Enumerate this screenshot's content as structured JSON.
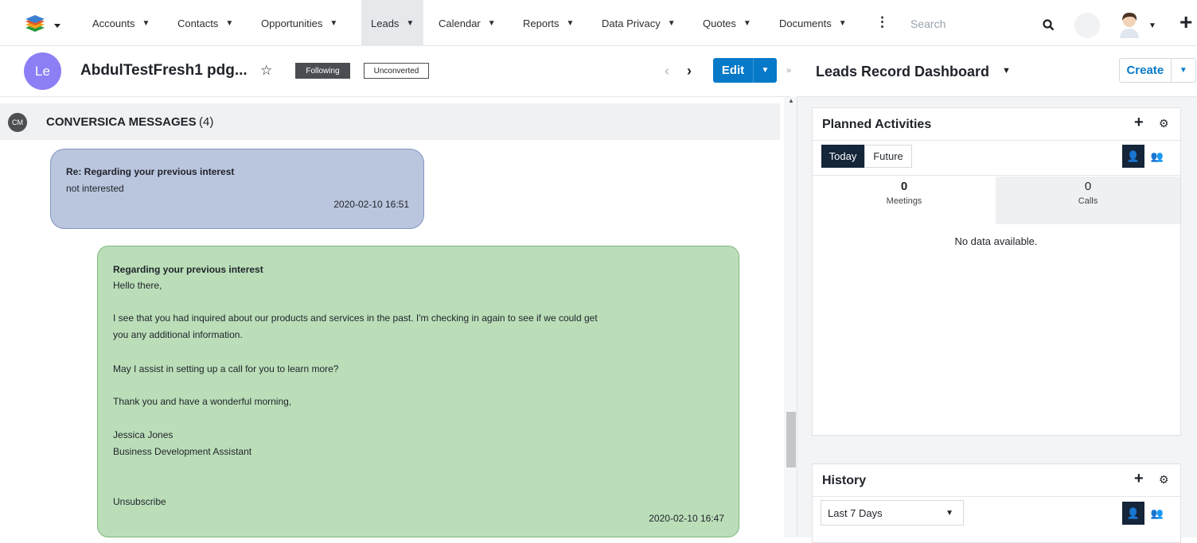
{
  "nav": {
    "items": [
      {
        "label": "Accounts"
      },
      {
        "label": "Contacts"
      },
      {
        "label": "Opportunities"
      },
      {
        "label": "Leads"
      },
      {
        "label": "Calendar"
      },
      {
        "label": "Reports"
      },
      {
        "label": "Data Privacy"
      },
      {
        "label": "Quotes"
      },
      {
        "label": "Documents"
      }
    ],
    "search_placeholder": "Search"
  },
  "record": {
    "avatar_initials": "Le",
    "title": "AbdulTestFresh1 pdg...",
    "following_badge": "Following",
    "status_badge": "Unconverted",
    "edit_label": "Edit"
  },
  "subpanel": {
    "icon_text": "CM",
    "title": "CONVERSICA MESSAGES",
    "count": "(4)"
  },
  "messages": [
    {
      "subject": "Re: Regarding your previous interest",
      "body": "not interested",
      "timestamp": "2020-02-10 16:51"
    },
    {
      "subject": "Regarding your previous interest",
      "lines": [
        "Hello there,",
        "I see that you had inquired about our products and services in the past. I'm checking in again to see if we could get",
        "you any additional information.",
        "May I assist in setting up a call for you to learn more?",
        "Thank you and have a wonderful morning,",
        "Jessica Jones",
        "Business Development Assistant",
        "Unsubscribe"
      ],
      "timestamp": "2020-02-10 16:47"
    }
  ],
  "dashboard": {
    "title": "Leads Record Dashboard",
    "create_label": "Create",
    "planned": {
      "title": "Planned Activities",
      "tab_today": "Today",
      "tab_future": "Future",
      "meetings_count": "0",
      "meetings_label": "Meetings",
      "calls_count": "0",
      "calls_label": "Calls",
      "empty_text": "No data available."
    },
    "history": {
      "title": "History",
      "filter_value": "Last 7 Days"
    }
  },
  "colors": {
    "accent": "#0679c8",
    "inbound_bubble": "#bac5de",
    "outbound_bubble": "#bbdeb9",
    "avatar": "#8c7ef5"
  }
}
